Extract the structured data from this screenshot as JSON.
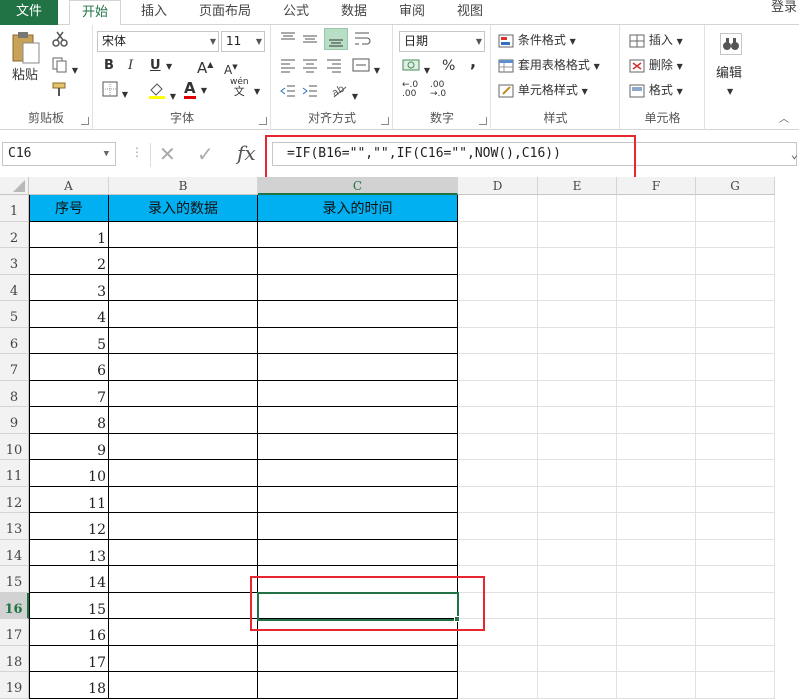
{
  "tabs": [
    {
      "label": "文件"
    },
    {
      "label": "开始"
    },
    {
      "label": "插入"
    },
    {
      "label": "页面布局"
    },
    {
      "label": "公式"
    },
    {
      "label": "数据"
    },
    {
      "label": "审阅"
    },
    {
      "label": "视图"
    }
  ],
  "active_tab": "开始",
  "login_label": "登录",
  "ribbon": {
    "clipboard": {
      "label": "剪贴板",
      "paste_label": "粘贴"
    },
    "font": {
      "label": "字体",
      "font_name": "宋体",
      "font_size": "11",
      "bold": "B",
      "italic": "I",
      "underline": "U",
      "grow": "A",
      "shrink": "A",
      "phonetic_top": "wén",
      "phonetic_bottom": "文"
    },
    "alignment": {
      "label": "对齐方式"
    },
    "number": {
      "label": "数字",
      "format": "日期",
      "percent": "%",
      "comma": ","
    },
    "styles": {
      "label": "样式",
      "conditional": "条件格式",
      "table": "套用表格格式",
      "cell_styles": "单元格样式"
    },
    "cells": {
      "label": "单元格",
      "insert": "插入",
      "delete": "删除",
      "format": "格式"
    },
    "editing": {
      "label": "编辑"
    }
  },
  "formula_bar": {
    "name_box": "C16",
    "cancel": "✕",
    "enter": "✓",
    "fx": "fx",
    "formula": "=IF(B16=\"\",\"\",IF(C16=\"\",NOW(),C16))"
  },
  "sheet": {
    "columns": [
      "A",
      "B",
      "C",
      "D",
      "E",
      "F",
      "G"
    ],
    "rows": [
      "1",
      "2",
      "3",
      "4",
      "5",
      "6",
      "7",
      "8",
      "9",
      "10",
      "11",
      "12",
      "13",
      "14",
      "15",
      "16",
      "17",
      "18",
      "19"
    ],
    "header_row": {
      "a": "序号",
      "b": "录入的数据",
      "c": "录入的时间"
    },
    "a_values": [
      "1",
      "2",
      "3",
      "4",
      "5",
      "6",
      "7",
      "8",
      "9",
      "10",
      "11",
      "12",
      "13",
      "14",
      "15",
      "16",
      "17",
      "18"
    ],
    "selected_cell": "C16",
    "selected_row": "16",
    "selected_col": "C",
    "header_fill": "#00b0f0",
    "annotation_color": "#e8262e",
    "selection_color": "#217346"
  }
}
